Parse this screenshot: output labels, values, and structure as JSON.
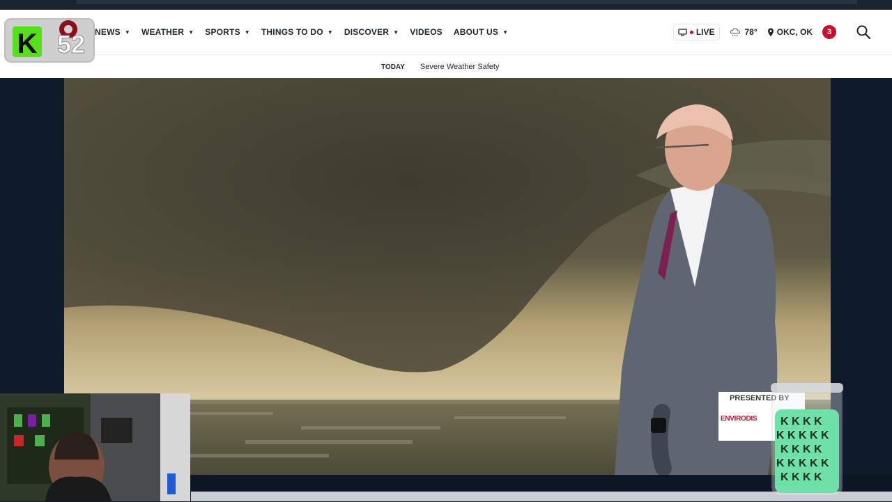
{
  "nav": {
    "items": [
      {
        "label": "NEWS",
        "has_dropdown": true
      },
      {
        "label": "WEATHER",
        "has_dropdown": true
      },
      {
        "label": "SPORTS",
        "has_dropdown": true
      },
      {
        "label": "THINGS TO DO",
        "has_dropdown": true
      },
      {
        "label": "DISCOVER",
        "has_dropdown": true
      },
      {
        "label": "VIDEOS",
        "has_dropdown": false
      },
      {
        "label": "ABOUT US",
        "has_dropdown": true
      }
    ]
  },
  "header_right": {
    "live_label": "LIVE",
    "temperature": "78°",
    "location": "OKC, OK",
    "notification_count": "3"
  },
  "subnav": {
    "today_label": "TODAY",
    "link": "Severe Weather Safety"
  },
  "logo": {
    "channel_number": "52",
    "letter": "K"
  },
  "sponsor": {
    "title": "PRESENTED BY",
    "brand": "ENVIRODIS"
  },
  "colors": {
    "accent_red": "#c8102e",
    "nav_text": "#1d2433",
    "logo_green": "#56e01b"
  }
}
